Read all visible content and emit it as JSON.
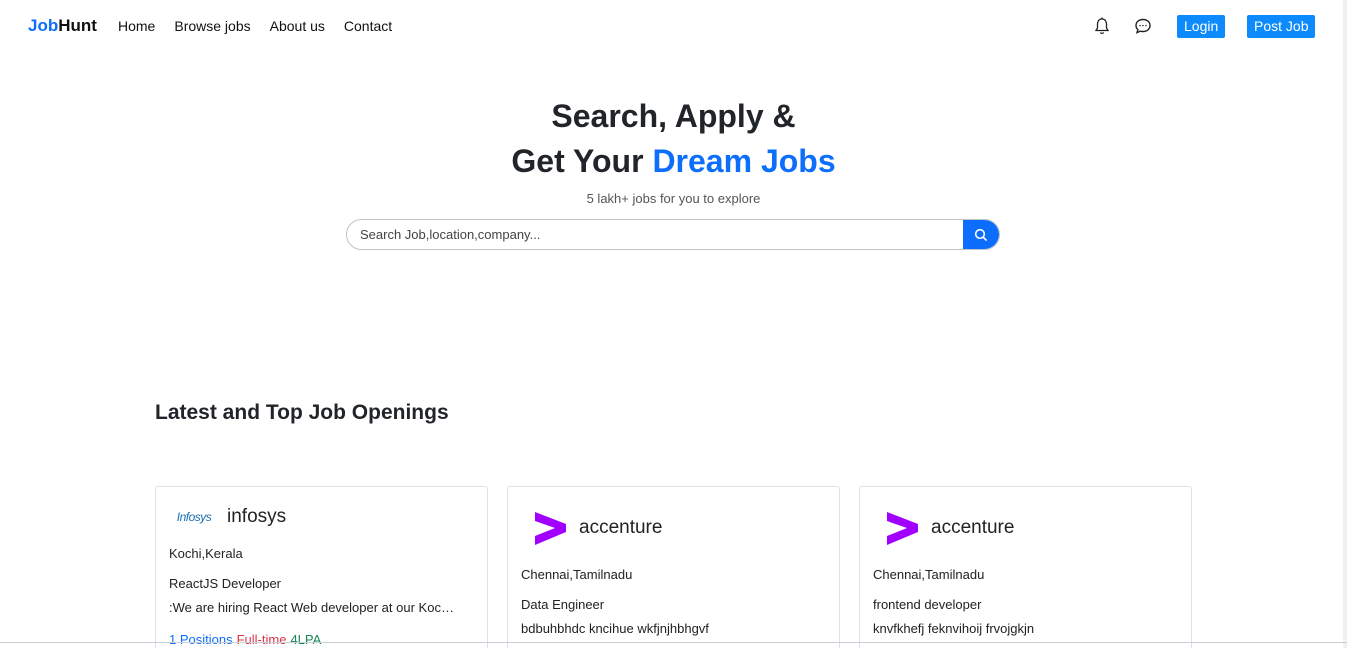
{
  "brand": {
    "part1": "Job",
    "part2": "Hunt"
  },
  "nav": {
    "links": [
      "Home",
      "Browse jobs",
      "About us",
      "Contact"
    ],
    "login": "Login",
    "post_job": "Post Job"
  },
  "hero": {
    "line1": "Search, Apply &",
    "line2_prefix": "Get Your ",
    "line2_accent": "Dream Jobs",
    "subtitle": "5 lakh+ jobs for you to explore"
  },
  "search": {
    "placeholder": "Search Job,location,company...",
    "value": ""
  },
  "section_title": "Latest and Top Job Openings",
  "jobs": [
    {
      "company": "infosys",
      "logo_text": "Infosys",
      "location": "Kochi,Kerala",
      "title": "ReactJS Developer",
      "description": ":We are hiring React Web developer at our Kochi office with good knowledge",
      "positions": "1 Positions",
      "type": "Full-time",
      "salary": "4LPA"
    },
    {
      "company": "accenture",
      "location": "Chennai,Tamilnadu",
      "title": "Data Engineer",
      "description": "bdbuhbhdc kncihue wkfjnjhbhgvf"
    },
    {
      "company": "accenture",
      "location": "Chennai,Tamilnadu",
      "title": "frontend developer",
      "description": "knvfkhefj feknvihoij frvojgkjn"
    }
  ],
  "colors": {
    "primary": "#0d6efd",
    "accenture_purple": "#a100ff",
    "danger": "#dc3545",
    "success": "#198754"
  }
}
